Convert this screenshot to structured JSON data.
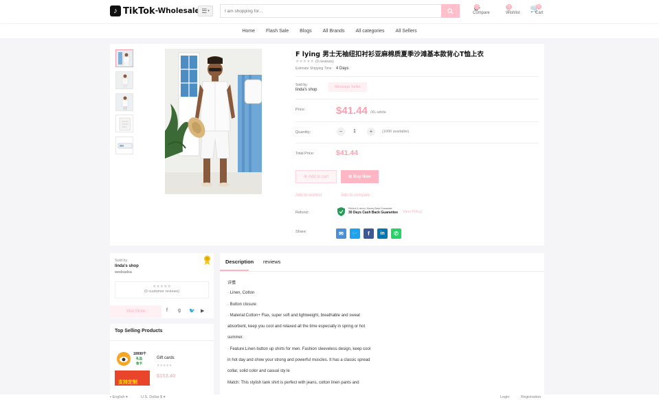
{
  "header": {
    "logo_text": "TikTok",
    "logo_sub": "-Wholesale",
    "search_placeholder": "I am shopping for...",
    "compare_label": "Compare",
    "compare_count": "0",
    "wishlist_label": "Wishlist",
    "wishlist_count": "0",
    "cart_label": "Cart",
    "cart_count": "0"
  },
  "nav": [
    "Home",
    "Flash Sale",
    "Blogs",
    "All Brands",
    "All categories",
    "All Sellers"
  ],
  "product": {
    "title": "F lying 男士无袖纽扣衬衫亚麻棉质夏季沙滩基本款背心T恤上衣",
    "reviews": "(0 reviews)",
    "shipping_label": "Estimate Shipping Time:",
    "shipping_value": "4 Days",
    "sold_by_label": "Sold by:",
    "seller": "linda's shop",
    "message_btn": "Message Seller",
    "price_label": "Price:",
    "price": "$41.44",
    "price_unit": "/XL-white",
    "quantity_label": "Quantity:",
    "quantity": "1",
    "available": "(1000 available)",
    "total_label": "Total Price:",
    "total": "$41.44",
    "add_to_cart": "Add to cart",
    "buy_now": "Buy Now",
    "add_wishlist": "Add to wishlist",
    "add_compare": "Add to compare",
    "refund_label": "Refund:",
    "refund_small": "Refund & return, Money-Back Guarantee",
    "refund_badge": "30 Days Cash Back Guarantee",
    "view_policy": "View Policy",
    "share_label": "Share:"
  },
  "seller_card": {
    "sold_by": "Sold by",
    "shop": "linda's shop",
    "sub": "wedsadsa",
    "reviews": "(0 customer reviews)",
    "visit": "Visit Store"
  },
  "top_selling": {
    "title": "Top Selling Products",
    "item_name": "Gift cards",
    "item_price": "$153.40",
    "img_text_1": "10000个",
    "img_text_2": "礼品",
    "img_text_3": "金卡",
    "img_text_4": "支持定制"
  },
  "tabs": [
    "Description",
    "reviews"
  ],
  "description": [
    "详情",
    "· Linen, Cotton",
    "· Button closure",
    "· Material:Cotton+ Flax, super soft and lightweight, breathable and sweat",
    "absorbent, keep you cool and relaxed all the time especially in spring or hot",
    "summer.",
    "· Feature:Linen button up shirts for men. Fashion sleeveless design, keep cool",
    "in hot day and show your strong and powerful muscles. It has a classic spread",
    "collar, solid color and casual sty le",
    "Match: This stylish tank shirt is perfect with jeans, cotton linen pants and"
  ],
  "footer": {
    "language": "English",
    "currency": "U.S. Dollar $",
    "login": "Login",
    "registration": "Registration"
  },
  "colors": {
    "accent": "#ffb6c4",
    "price": "#ff9eb0",
    "email": "#4a90d9",
    "twitter": "#1da1f2",
    "facebook": "#3b5998",
    "linkedin": "#0077b5",
    "whatsapp": "#25d366"
  }
}
